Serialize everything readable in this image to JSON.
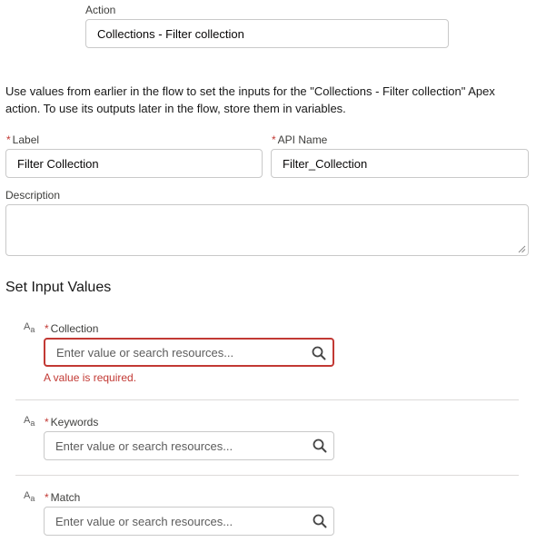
{
  "action": {
    "label": "Action",
    "value": "Collections - Filter collection"
  },
  "intro_text": "Use values from earlier in the flow to set the inputs for the \"Collections - Filter collection\" Apex action. To use its outputs later in the flow, store them in variables.",
  "label_field": {
    "label": "Label",
    "value": "Filter Collection"
  },
  "api_field": {
    "label": "API Name",
    "value": "Filter_Collection"
  },
  "description_field": {
    "label": "Description",
    "value": ""
  },
  "required_marker": "*",
  "section_title": "Set Input Values",
  "inputs": [
    {
      "type_icon": "text-type-icon",
      "label": "Collection",
      "placeholder": "Enter value or search resources...",
      "error": "A value is required."
    },
    {
      "type_icon": "text-type-icon",
      "label": "Keywords",
      "placeholder": "Enter value or search resources..."
    },
    {
      "type_icon": "text-type-icon",
      "label": "Match",
      "placeholder": "Enter value or search resources..."
    }
  ],
  "type_icon_glyph": "Aa",
  "colors": {
    "error": "#c23934",
    "border": "#c9c9c9",
    "divider": "#dddbda"
  }
}
